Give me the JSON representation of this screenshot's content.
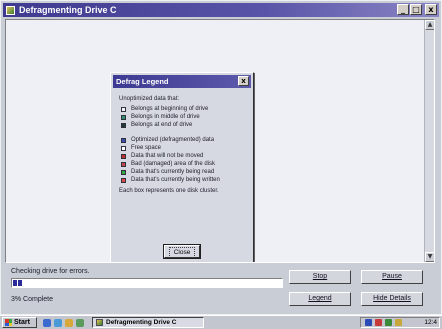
{
  "window": {
    "title": "Defragmenting Drive C",
    "minimize_glyph": "_",
    "restore_glyph": "□",
    "close_glyph": "x"
  },
  "legend_dialog": {
    "title": "Defrag Legend",
    "close_glyph": "x",
    "heading": "Unoptimized data that:",
    "group1": [
      {
        "label": "Belongs at beginning of drive",
        "color": "#f4f4f4"
      },
      {
        "label": "Belongs in middle of drive",
        "color": "#2f8f6a"
      },
      {
        "label": "Belongs at end of drive",
        "color": "#1f3a2e"
      }
    ],
    "group2": [
      {
        "label": "Optimized (defragmented) data",
        "color": "#3b4fb0"
      },
      {
        "label": "Free space",
        "color": "#ffffff"
      },
      {
        "label": "Data that will not be moved",
        "color": "#c03030"
      },
      {
        "label": "Bad (damaged) area of the disk",
        "color": "#c04848"
      },
      {
        "label": "Data that's currently being read",
        "color": "#30a840"
      },
      {
        "label": "Data that's currently being written",
        "color": "#e04848"
      }
    ],
    "note": "Each box represents one disk cluster.",
    "close_button": "Close"
  },
  "status": {
    "message": "Checking drive for errors.",
    "percent_label": "3% Complete",
    "progress_fraction": 0.03,
    "progress_color": "#2a2a9a"
  },
  "buttons": {
    "stop": "Stop",
    "pause": "Pause",
    "legend": "Legend",
    "hide_details": "Hide Details"
  },
  "taskbar": {
    "start": "Start",
    "task": "Defragmenting Drive C",
    "clock": "12:4"
  }
}
